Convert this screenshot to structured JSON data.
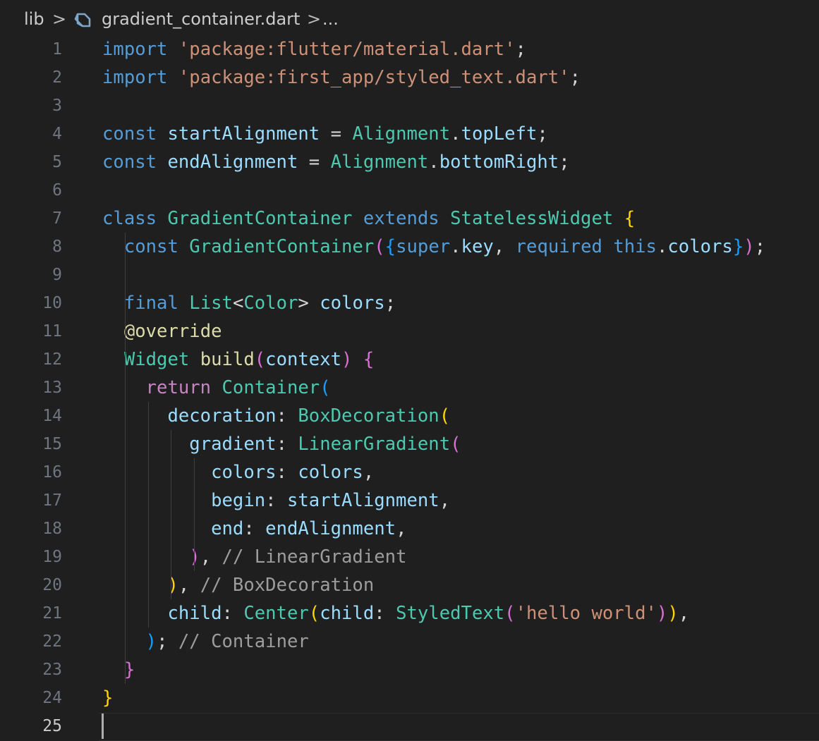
{
  "breadcrumb": {
    "folder": "lib",
    "separator": ">",
    "file": "gradient_container.dart",
    "more": "..."
  },
  "file_icon": "dart-icon",
  "editor": {
    "active_line": 25,
    "line_numbers": [
      "1",
      "2",
      "3",
      "4",
      "5",
      "6",
      "7",
      "8",
      "9",
      "10",
      "11",
      "12",
      "13",
      "14",
      "15",
      "16",
      "17",
      "18",
      "19",
      "20",
      "21",
      "22",
      "23",
      "24",
      "25"
    ],
    "lines": [
      [
        [
          "kw",
          "import"
        ],
        [
          "p",
          " "
        ],
        [
          "str",
          "'package:flutter/material.dart'"
        ],
        [
          "p",
          ";"
        ]
      ],
      [
        [
          "kw",
          "import"
        ],
        [
          "p",
          " "
        ],
        [
          "str",
          "'package:first_app/styled_text.dart'"
        ],
        [
          "p",
          ";"
        ]
      ],
      [],
      [
        [
          "kw",
          "const"
        ],
        [
          "p",
          " "
        ],
        [
          "var",
          "startAlignment"
        ],
        [
          "p",
          " = "
        ],
        [
          "ty",
          "Alignment"
        ],
        [
          "p",
          "."
        ],
        [
          "var",
          "topLeft"
        ],
        [
          "p",
          ";"
        ]
      ],
      [
        [
          "kw",
          "const"
        ],
        [
          "p",
          " "
        ],
        [
          "var",
          "endAlignment"
        ],
        [
          "p",
          " = "
        ],
        [
          "ty",
          "Alignment"
        ],
        [
          "p",
          "."
        ],
        [
          "var",
          "bottomRight"
        ],
        [
          "p",
          ";"
        ]
      ],
      [],
      [
        [
          "kw",
          "class"
        ],
        [
          "p",
          " "
        ],
        [
          "ty",
          "GradientContainer"
        ],
        [
          "p",
          " "
        ],
        [
          "kw",
          "extends"
        ],
        [
          "p",
          " "
        ],
        [
          "ty",
          "StatelessWidget"
        ],
        [
          "p",
          " "
        ],
        [
          "b1",
          "{"
        ]
      ],
      [
        [
          "p",
          "  "
        ],
        [
          "kw",
          "const"
        ],
        [
          "p",
          " "
        ],
        [
          "ty",
          "GradientContainer"
        ],
        [
          "b2",
          "("
        ],
        [
          "b3",
          "{"
        ],
        [
          "kw",
          "super"
        ],
        [
          "p",
          "."
        ],
        [
          "var",
          "key"
        ],
        [
          "p",
          ", "
        ],
        [
          "kw",
          "required"
        ],
        [
          "p",
          " "
        ],
        [
          "kw",
          "this"
        ],
        [
          "p",
          "."
        ],
        [
          "var",
          "colors"
        ],
        [
          "b3",
          "}"
        ],
        [
          "b2",
          ")"
        ],
        [
          "p",
          ";"
        ]
      ],
      [],
      [
        [
          "p",
          "  "
        ],
        [
          "kw",
          "final"
        ],
        [
          "p",
          " "
        ],
        [
          "ty",
          "List"
        ],
        [
          "p",
          "<"
        ],
        [
          "ty",
          "Color"
        ],
        [
          "p",
          "> "
        ],
        [
          "var",
          "colors"
        ],
        [
          "p",
          ";"
        ]
      ],
      [
        [
          "p",
          "  "
        ],
        [
          "fn",
          "@override"
        ]
      ],
      [
        [
          "p",
          "  "
        ],
        [
          "ty",
          "Widget"
        ],
        [
          "p",
          " "
        ],
        [
          "fn",
          "build"
        ],
        [
          "b2",
          "("
        ],
        [
          "var",
          "context"
        ],
        [
          "b2",
          ")"
        ],
        [
          "p",
          " "
        ],
        [
          "b2",
          "{"
        ]
      ],
      [
        [
          "p",
          "    "
        ],
        [
          "ctl",
          "return"
        ],
        [
          "p",
          " "
        ],
        [
          "ty",
          "Container"
        ],
        [
          "b3",
          "("
        ]
      ],
      [
        [
          "p",
          "      "
        ],
        [
          "var",
          "decoration"
        ],
        [
          "p",
          ": "
        ],
        [
          "ty",
          "BoxDecoration"
        ],
        [
          "b1",
          "("
        ]
      ],
      [
        [
          "p",
          "        "
        ],
        [
          "var",
          "gradient"
        ],
        [
          "p",
          ": "
        ],
        [
          "ty",
          "LinearGradient"
        ],
        [
          "b2",
          "("
        ]
      ],
      [
        [
          "p",
          "          "
        ],
        [
          "var",
          "colors"
        ],
        [
          "p",
          ": "
        ],
        [
          "var",
          "colors"
        ],
        [
          "p",
          ","
        ]
      ],
      [
        [
          "p",
          "          "
        ],
        [
          "var",
          "begin"
        ],
        [
          "p",
          ": "
        ],
        [
          "var",
          "startAlignment"
        ],
        [
          "p",
          ","
        ]
      ],
      [
        [
          "p",
          "          "
        ],
        [
          "var",
          "end"
        ],
        [
          "p",
          ": "
        ],
        [
          "var",
          "endAlignment"
        ],
        [
          "p",
          ","
        ]
      ],
      [
        [
          "p",
          "        "
        ],
        [
          "b2",
          ")"
        ],
        [
          "p",
          ", "
        ],
        [
          "cmt",
          "// LinearGradient"
        ]
      ],
      [
        [
          "p",
          "      "
        ],
        [
          "b1",
          ")"
        ],
        [
          "p",
          ", "
        ],
        [
          "cmt",
          "// BoxDecoration"
        ]
      ],
      [
        [
          "p",
          "      "
        ],
        [
          "var",
          "child"
        ],
        [
          "p",
          ": "
        ],
        [
          "ty",
          "Center"
        ],
        [
          "b1",
          "("
        ],
        [
          "var",
          "child"
        ],
        [
          "p",
          ": "
        ],
        [
          "ty",
          "StyledText"
        ],
        [
          "b2",
          "("
        ],
        [
          "str",
          "'hello world'"
        ],
        [
          "b2",
          ")"
        ],
        [
          "b1",
          ")"
        ],
        [
          "p",
          ","
        ]
      ],
      [
        [
          "p",
          "    "
        ],
        [
          "b3",
          ")"
        ],
        [
          "p",
          "; "
        ],
        [
          "cmt",
          "// Container"
        ]
      ],
      [
        [
          "p",
          "  "
        ],
        [
          "b2",
          "}"
        ]
      ],
      [
        [
          "b1",
          "}"
        ]
      ],
      []
    ]
  }
}
